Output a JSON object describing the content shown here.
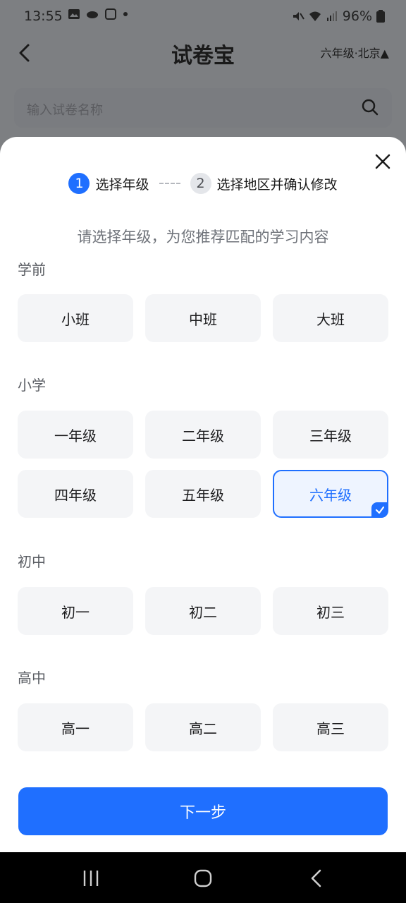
{
  "status": {
    "time": "13:55",
    "battery": "96%"
  },
  "header": {
    "title": "试卷宝",
    "region": "六年级·北京▲"
  },
  "search": {
    "placeholder": "输入试卷名称"
  },
  "steps": [
    {
      "num": "1",
      "label": "选择年级",
      "active": true
    },
    {
      "num": "2",
      "label": "选择地区并确认修改",
      "active": false
    }
  ],
  "subtitle": "请选择年级，为您推荐匹配的学习内容",
  "sections": [
    {
      "label": "学前",
      "options": [
        "小班",
        "中班",
        "大班"
      ]
    },
    {
      "label": "小学",
      "options": [
        "一年级",
        "二年级",
        "三年级",
        "四年级",
        "五年级",
        "六年级"
      ]
    },
    {
      "label": "初中",
      "options": [
        "初一",
        "初二",
        "初三"
      ]
    },
    {
      "label": "高中",
      "options": [
        "高一",
        "高二",
        "高三"
      ]
    }
  ],
  "selected_grade": "六年级",
  "next_button": "下一步",
  "colors": {
    "accent": "#1f6fff",
    "option_bg": "#f4f5f7"
  }
}
